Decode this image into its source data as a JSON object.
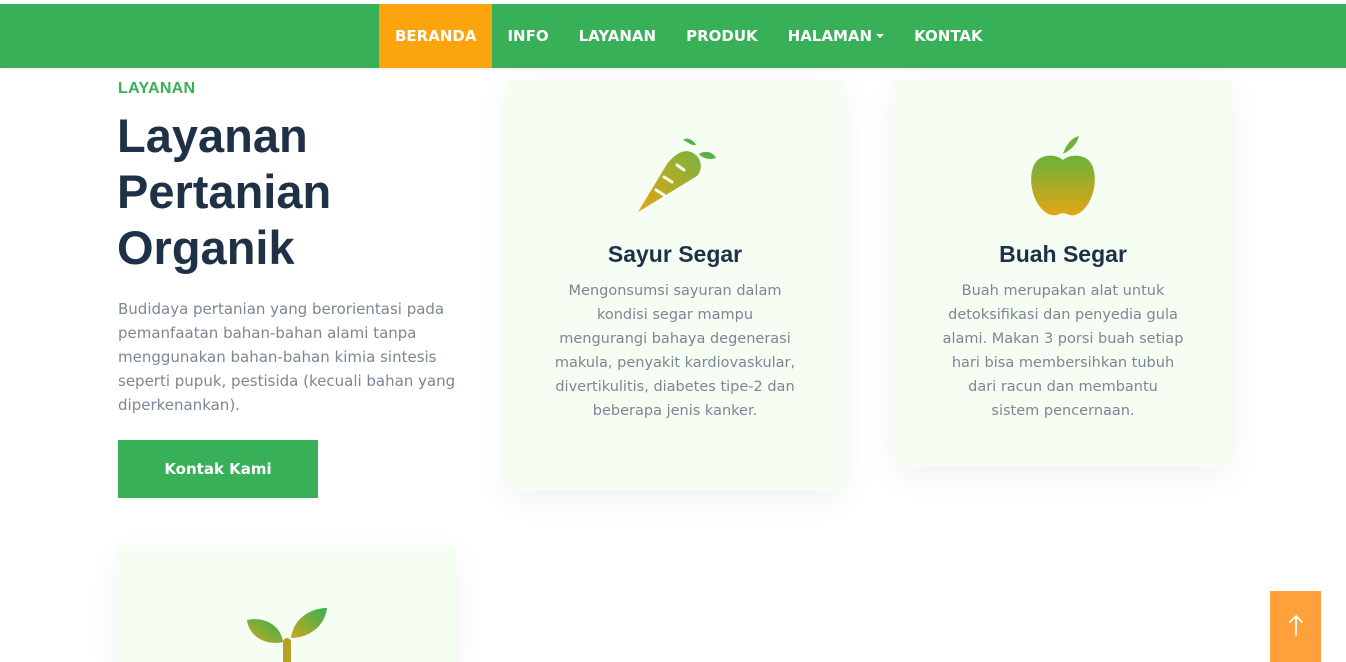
{
  "nav": {
    "items": [
      {
        "label": "BERANDA"
      },
      {
        "label": "INFO"
      },
      {
        "label": "LAYANAN"
      },
      {
        "label": "PRODUK"
      },
      {
        "label": "HALAMAN"
      },
      {
        "label": "KONTAK"
      }
    ],
    "active_item": "BERANDA"
  },
  "intro": {
    "eyebrow": "LAYANAN",
    "headline": [
      "Layanan",
      "Pertanian",
      "Organik"
    ],
    "text": "Budidaya pertanian yang berorientasi pada pemanfaatan bahan-bahan alami tanpa menggunakan bahan-bahan kimia sintesis seperti pupuk, pestisida (kecuali bahan yang diperkenankan).",
    "button_label": "Kontak Kami"
  },
  "services": [
    {
      "icon": "carrot-icon",
      "title": "Sayur Segar",
      "text": "Mengonsumsi sayuran dalam kondisi segar mampu mengurangi bahaya degenerasi makula, penyakit kardiovaskular, divertikulitis, diabetes tipe-2 dan beberapa jenis kanker."
    },
    {
      "icon": "apple-icon",
      "title": "Buah Segar",
      "text": "Buah merupakan alat untuk detoksifikasi dan penyedia gula alami. Makan 3 porsi buah setiap hari bisa membersihkan tubuh dari racun dan membantu sistem pencernaan."
    },
    {
      "icon": "sprout-icon"
    }
  ],
  "colors": {
    "brand_green": "#37b058",
    "active_orange": "#fca40d",
    "heading_navy": "#1f3147",
    "body_gray": "#7b8794",
    "card_bg": "#f6fdf2",
    "back_to_top": "#ffa03a"
  },
  "back_to_top_icon": "arrow-up-icon"
}
